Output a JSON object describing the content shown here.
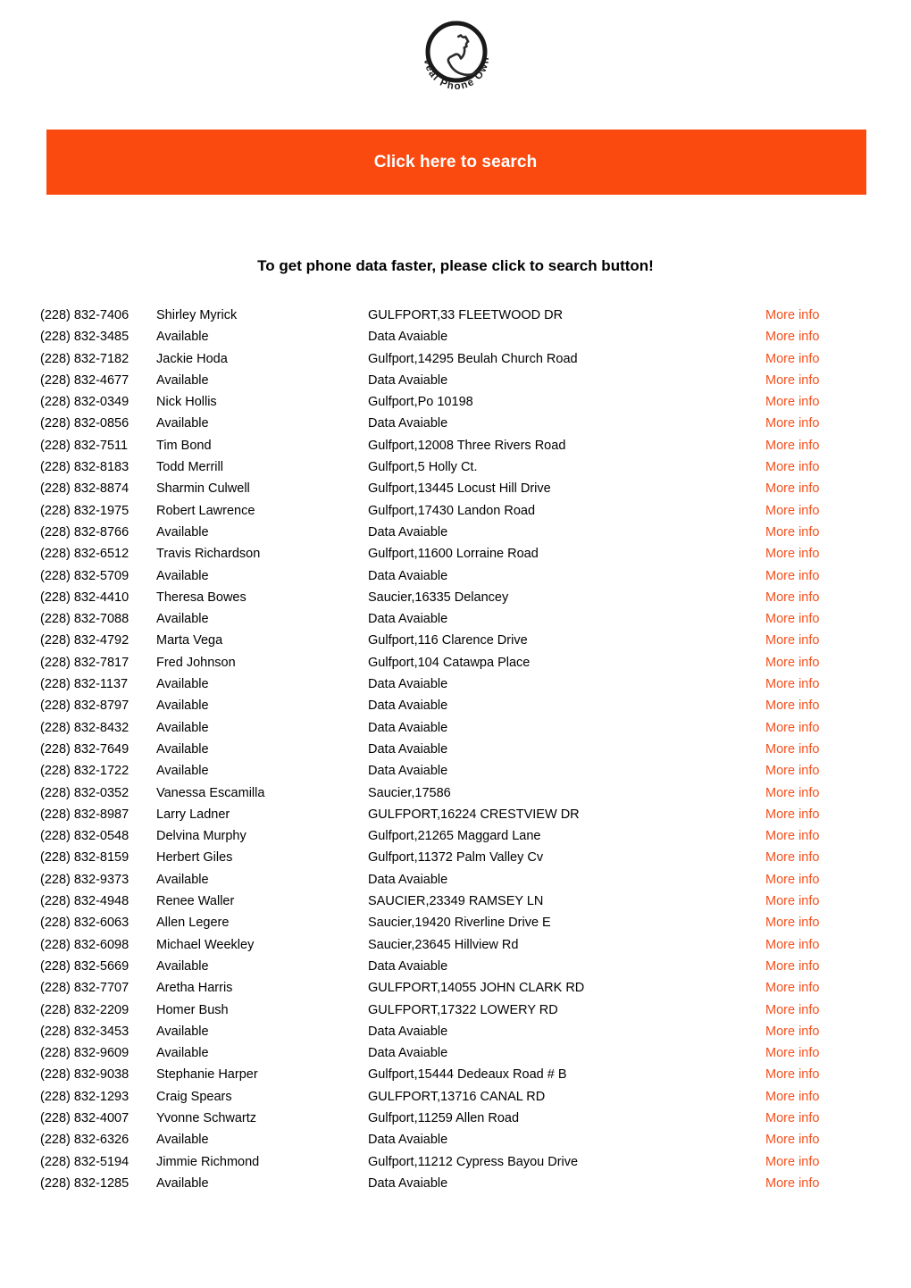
{
  "logo": {
    "brand_line_1": "Reveal",
    "brand_line_2": "Phone",
    "brand_line_3": "Owner",
    "brand_text": "Reveal Phone Owner",
    "icon": "phone-handset-icon"
  },
  "cta": {
    "label": "Click here to search",
    "background_color": "#fb4a10",
    "text_color": "#ffffff"
  },
  "headline": {
    "text": "To get phone data faster, please click to search button!"
  },
  "listing": {
    "more_info_label": "More info",
    "more_info_color": "#f4511e",
    "placeholder_name": "Available",
    "placeholder_address": "Data Avaiable",
    "rows": [
      {
        "phone": "(228) 832-7406",
        "name": "Shirley Myrick",
        "address": "GULFPORT,33 FLEETWOOD DR",
        "more": "More info"
      },
      {
        "phone": "(228) 832-3485",
        "name": "Available",
        "address": "Data Avaiable",
        "more": "More info"
      },
      {
        "phone": "(228) 832-7182",
        "name": "Jackie Hoda",
        "address": "Gulfport,14295 Beulah Church Road",
        "more": "More info"
      },
      {
        "phone": "(228) 832-4677",
        "name": "Available",
        "address": "Data Avaiable",
        "more": "More info"
      },
      {
        "phone": "(228) 832-0349",
        "name": "Nick Hollis",
        "address": "Gulfport,Po 10198",
        "more": "More info"
      },
      {
        "phone": "(228) 832-0856",
        "name": "Available",
        "address": "Data Avaiable",
        "more": "More info"
      },
      {
        "phone": "(228) 832-7511",
        "name": "Tim Bond",
        "address": "Gulfport,12008 Three Rivers Road",
        "more": "More info"
      },
      {
        "phone": "(228) 832-8183",
        "name": "Todd Merrill",
        "address": "Gulfport,5 Holly Ct.",
        "more": "More info"
      },
      {
        "phone": "(228) 832-8874",
        "name": "Sharmin Culwell",
        "address": "Gulfport,13445 Locust Hill Drive",
        "more": "More info"
      },
      {
        "phone": "(228) 832-1975",
        "name": "Robert Lawrence",
        "address": "Gulfport,17430 Landon Road",
        "more": "More info"
      },
      {
        "phone": "(228) 832-8766",
        "name": "Available",
        "address": "Data Avaiable",
        "more": "More info"
      },
      {
        "phone": "(228) 832-6512",
        "name": "Travis Richardson",
        "address": "Gulfport,11600 Lorraine Road",
        "more": "More info"
      },
      {
        "phone": "(228) 832-5709",
        "name": "Available",
        "address": "Data Avaiable",
        "more": "More info"
      },
      {
        "phone": "(228) 832-4410",
        "name": "Theresa Bowes",
        "address": "Saucier,16335 Delancey",
        "more": "More info"
      },
      {
        "phone": "(228) 832-7088",
        "name": "Available",
        "address": "Data Avaiable",
        "more": "More info"
      },
      {
        "phone": "(228) 832-4792",
        "name": "Marta Vega",
        "address": "Gulfport,116 Clarence Drive",
        "more": "More info"
      },
      {
        "phone": "(228) 832-7817",
        "name": "Fred Johnson",
        "address": "Gulfport,104 Catawpa Place",
        "more": "More info"
      },
      {
        "phone": "(228) 832-1137",
        "name": "Available",
        "address": "Data Avaiable",
        "more": "More info"
      },
      {
        "phone": "(228) 832-8797",
        "name": "Available",
        "address": "Data Avaiable",
        "more": "More info"
      },
      {
        "phone": "(228) 832-8432",
        "name": "Available",
        "address": "Data Avaiable",
        "more": "More info"
      },
      {
        "phone": "(228) 832-7649",
        "name": "Available",
        "address": "Data Avaiable",
        "more": "More info"
      },
      {
        "phone": "(228) 832-1722",
        "name": "Available",
        "address": "Data Avaiable",
        "more": "More info"
      },
      {
        "phone": "(228) 832-0352",
        "name": "Vanessa Escamilla",
        "address": "Saucier,17586",
        "more": "More info"
      },
      {
        "phone": "(228) 832-8987",
        "name": "Larry Ladner",
        "address": "GULFPORT,16224 CRESTVIEW DR",
        "more": "More info"
      },
      {
        "phone": "(228) 832-0548",
        "name": "Delvina Murphy",
        "address": "Gulfport,21265 Maggard Lane",
        "more": "More info"
      },
      {
        "phone": "(228) 832-8159",
        "name": "Herbert Giles",
        "address": "Gulfport,11372 Palm Valley Cv",
        "more": "More info"
      },
      {
        "phone": "(228) 832-9373",
        "name": "Available",
        "address": "Data Avaiable",
        "more": "More info"
      },
      {
        "phone": "(228) 832-4948",
        "name": "Renee Waller",
        "address": "SAUCIER,23349 RAMSEY LN",
        "more": "More info"
      },
      {
        "phone": "(228) 832-6063",
        "name": "Allen Legere",
        "address": "Saucier,19420 Riverline Drive E",
        "more": "More info"
      },
      {
        "phone": "(228) 832-6098",
        "name": "Michael Weekley",
        "address": "Saucier,23645 Hillview Rd",
        "more": "More info"
      },
      {
        "phone": "(228) 832-5669",
        "name": "Available",
        "address": "Data Avaiable",
        "more": "More info"
      },
      {
        "phone": "(228) 832-7707",
        "name": "Aretha Harris",
        "address": "GULFPORT,14055 JOHN CLARK RD",
        "more": "More info"
      },
      {
        "phone": "(228) 832-2209",
        "name": "Homer Bush",
        "address": "GULFPORT,17322 LOWERY RD",
        "more": "More info"
      },
      {
        "phone": "(228) 832-3453",
        "name": "Available",
        "address": "Data Avaiable",
        "more": "More info"
      },
      {
        "phone": "(228) 832-9609",
        "name": "Available",
        "address": "Data Avaiable",
        "more": "More info"
      },
      {
        "phone": "(228) 832-9038",
        "name": "Stephanie Harper",
        "address": "Gulfport,15444 Dedeaux Road # B",
        "more": "More info"
      },
      {
        "phone": "(228) 832-1293",
        "name": "Craig Spears",
        "address": "GULFPORT,13716 CANAL RD",
        "more": "More info"
      },
      {
        "phone": "(228) 832-4007",
        "name": "Yvonne Schwartz",
        "address": "Gulfport,11259 Allen Road",
        "more": "More info"
      },
      {
        "phone": "(228) 832-6326",
        "name": "Available",
        "address": "Data Avaiable",
        "more": "More info"
      },
      {
        "phone": "(228) 832-5194",
        "name": "Jimmie Richmond",
        "address": "Gulfport,11212 Cypress Bayou Drive",
        "more": "More info"
      },
      {
        "phone": "(228) 832-1285",
        "name": "Available",
        "address": "Data Avaiable",
        "more": "More info"
      }
    ]
  }
}
